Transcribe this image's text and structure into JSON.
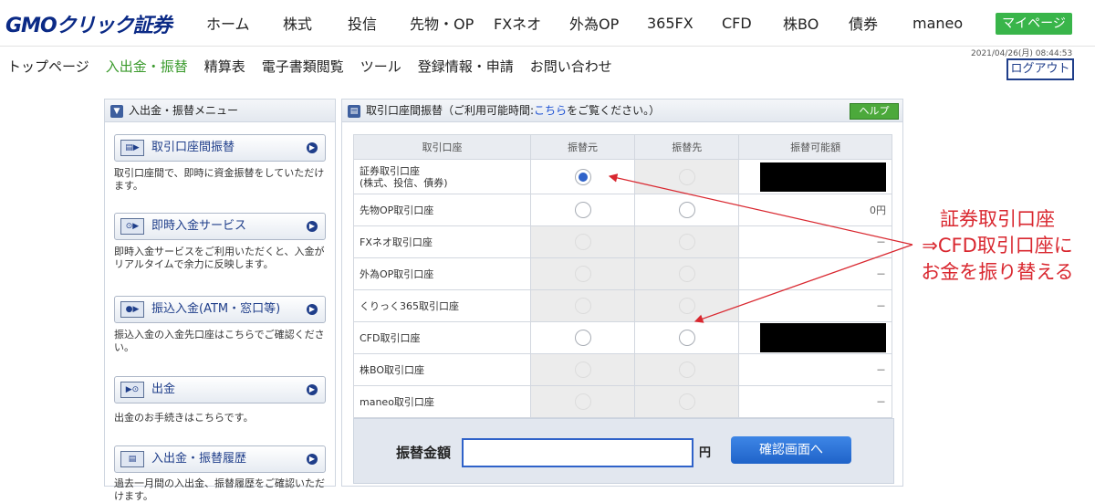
{
  "header": {
    "logo": "GMOクリック証券",
    "nav": [
      "ホーム",
      "株式",
      "投信",
      "先物・OP",
      "FXネオ",
      "外為OP",
      "365FX",
      "CFD",
      "株BO",
      "債券",
      "maneo"
    ],
    "mypage": "マイページ",
    "datetime": "2021/04/26(月) 08:44:53"
  },
  "subnav": {
    "items": [
      "トップページ",
      "入出金・振替",
      "精算表",
      "電子書類閲覧",
      "ツール",
      "登録情報・申請",
      "お問い合わせ"
    ],
    "active_index": 1,
    "logout": "ログアウト"
  },
  "left_menu": {
    "title": "入出金・振替メニュー",
    "items": [
      {
        "label": "取引口座間振替",
        "desc": "取引口座間で、即時に資金振替をしていただけます。"
      },
      {
        "label": "即時入金サービス",
        "desc": "即時入金サービスをご利用いただくと、入金がリアルタイムで余力に反映します。"
      },
      {
        "label": "振込入金(ATM・窓口等)",
        "desc": "振込入金の入金先口座はこちらでご確認ください。"
      },
      {
        "label": "出金",
        "desc": "出金のお手続きはこちらです。"
      },
      {
        "label": "入出金・振替履歴",
        "desc": "過去一月間の入出金、振替履歴をご確認いただけます。"
      }
    ]
  },
  "transfer": {
    "title_prefix": "取引口座間振替（ご利用可能時間:",
    "title_link": "こちら",
    "title_suffix": "をご覧ください。）",
    "help": "ヘルプ",
    "headers": [
      "取引口座",
      "振替元",
      "振替先",
      "振替可能額"
    ],
    "rows": [
      {
        "account": "証券取引口座\n(株式、投信、債券)",
        "from": "selected",
        "to": "disabled",
        "amount": "",
        "redacted": true
      },
      {
        "account": "先物OP取引口座",
        "from": "enabled",
        "to": "enabled",
        "amount": "0円",
        "redacted": false
      },
      {
        "account": "FXネオ取引口座",
        "from": "disabled",
        "to": "disabled",
        "amount": "－",
        "redacted": false
      },
      {
        "account": "外為OP取引口座",
        "from": "disabled",
        "to": "disabled",
        "amount": "－",
        "redacted": false
      },
      {
        "account": "くりっく365取引口座",
        "from": "disabled",
        "to": "disabled",
        "amount": "－",
        "redacted": false
      },
      {
        "account": "CFD取引口座",
        "from": "enabled",
        "to": "enabled",
        "amount": "",
        "redacted": true
      },
      {
        "account": "株BO取引口座",
        "from": "disabled",
        "to": "disabled",
        "amount": "－",
        "redacted": false
      },
      {
        "account": "maneo取引口座",
        "from": "disabled",
        "to": "disabled",
        "amount": "－",
        "redacted": false
      }
    ],
    "amount_label": "振替金額",
    "amount_value": "",
    "unit": "円",
    "confirm": "確認画面へ"
  },
  "annotation": {
    "lines": [
      "証券取引口座",
      "⇒CFD取引口座に",
      "お金を振り替える"
    ],
    "color": "#d9272f"
  }
}
